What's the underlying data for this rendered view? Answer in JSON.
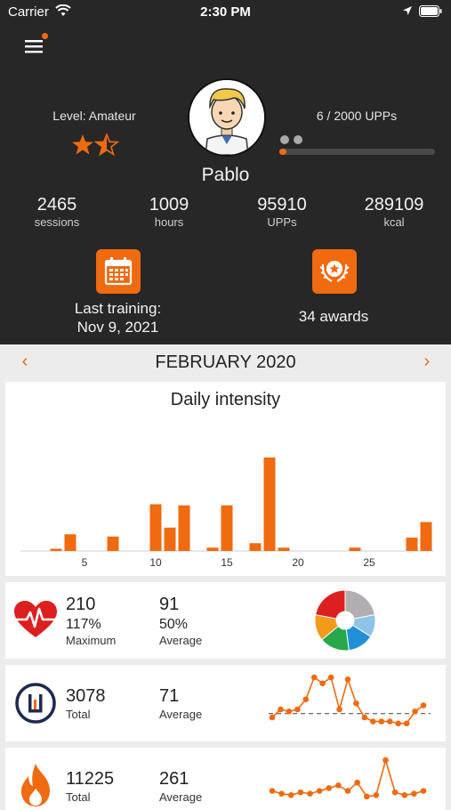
{
  "status_bar": {
    "carrier": "Carrier",
    "time": "2:30 PM"
  },
  "profile": {
    "level": "Level: Amateur",
    "stars_filled": 1.5,
    "stars_total": 2,
    "name": "Pablo",
    "upps_progress_text": "6 / 2000 UPPs",
    "upps_progress": 0.003
  },
  "stats": [
    {
      "value": "2465",
      "label": "sessions"
    },
    {
      "value": "1009",
      "label": "hours"
    },
    {
      "value": "95910",
      "label": "UPPs"
    },
    {
      "value": "289109",
      "label": "kcal"
    }
  ],
  "last_training": {
    "line1": "Last training:",
    "line2": "Nov 9, 2021"
  },
  "awards": {
    "text": "34 awards"
  },
  "month_nav": {
    "month": "FEBRUARY 2020",
    "prev": "‹",
    "next": "›"
  },
  "chart_data": {
    "type": "bar",
    "title": "Daily intensity",
    "x": [
      1,
      2,
      3,
      4,
      5,
      6,
      7,
      8,
      9,
      10,
      11,
      12,
      13,
      14,
      15,
      16,
      17,
      18,
      19,
      20,
      21,
      22,
      23,
      24,
      25,
      26,
      27,
      28,
      29
    ],
    "values": [
      0,
      0,
      2,
      15,
      0,
      0,
      13,
      0,
      0,
      42,
      21,
      41,
      0,
      3,
      41,
      0,
      7,
      84,
      3,
      0,
      0,
      0,
      0,
      3,
      0,
      0,
      0,
      12,
      26
    ],
    "xticks": [
      5,
      10,
      15,
      20,
      25
    ],
    "ylim": [
      0,
      100
    ],
    "color": "#f06a0f"
  },
  "heart": {
    "value1": "210",
    "pct1": "117%",
    "label1": "Maximum",
    "value2": "91",
    "pct2": "50%",
    "label2": "Average",
    "zones": [
      {
        "color": "#b0aeb0",
        "share": 0.22
      },
      {
        "color": "#8fc3e8",
        "share": 0.12
      },
      {
        "color": "#2290d8",
        "share": 0.14
      },
      {
        "color": "#27a84a",
        "share": 0.16
      },
      {
        "color": "#f39a1a",
        "share": 0.14
      },
      {
        "color": "#dc1f1f",
        "share": 0.22
      }
    ]
  },
  "upp_card": {
    "value1": "3078",
    "label1": "Total",
    "value2": "71",
    "label2": "Average",
    "spark": [
      4,
      8,
      7,
      8,
      13,
      24,
      21,
      24,
      8,
      23,
      11,
      4,
      2,
      2,
      2,
      1,
      1,
      7,
      10
    ]
  },
  "kcal_card": {
    "value1": "11225",
    "label1": "Total",
    "value2": "261",
    "label2": "Average",
    "spark": [
      6,
      4,
      3,
      5,
      4,
      6,
      8,
      10,
      6,
      12,
      2,
      3,
      28,
      5,
      3,
      4,
      6
    ]
  },
  "colors": {
    "accent": "#f06a0f",
    "dark": "#272727"
  }
}
